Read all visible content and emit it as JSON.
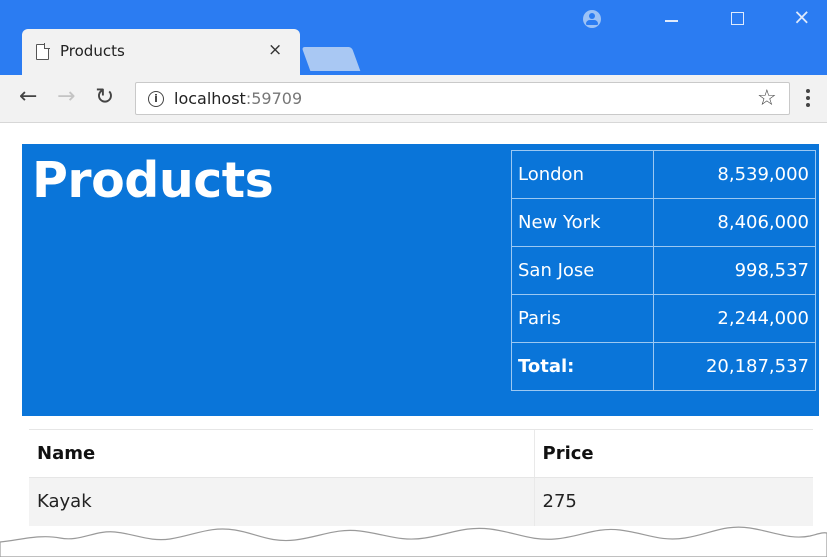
{
  "browser": {
    "tab_title": "Products",
    "tab_close": "×",
    "window_controls": {
      "minimize": "minimize-icon",
      "maximize": "maximize-icon",
      "close": "×"
    },
    "url_host": "localhost",
    "url_port": ":59709",
    "icons": [
      "page-icon",
      "back-arrow-icon",
      "forward-arrow-icon",
      "reload-icon",
      "info-icon",
      "star-icon",
      "menu-icon",
      "profile-icon"
    ]
  },
  "page": {
    "title": "Products",
    "accent_color": "#0a75d9",
    "cities": [
      {
        "name": "London",
        "population": "8,539,000"
      },
      {
        "name": "New York",
        "population": "8,406,000"
      },
      {
        "name": "San Jose",
        "population": "998,537"
      },
      {
        "name": "Paris",
        "population": "2,244,000"
      }
    ],
    "total": {
      "label": "Total:",
      "value": "20,187,537"
    },
    "products_table": {
      "headers": [
        "Name",
        "Price"
      ],
      "rows": [
        {
          "name": "Kayak",
          "price": "275"
        }
      ]
    }
  }
}
